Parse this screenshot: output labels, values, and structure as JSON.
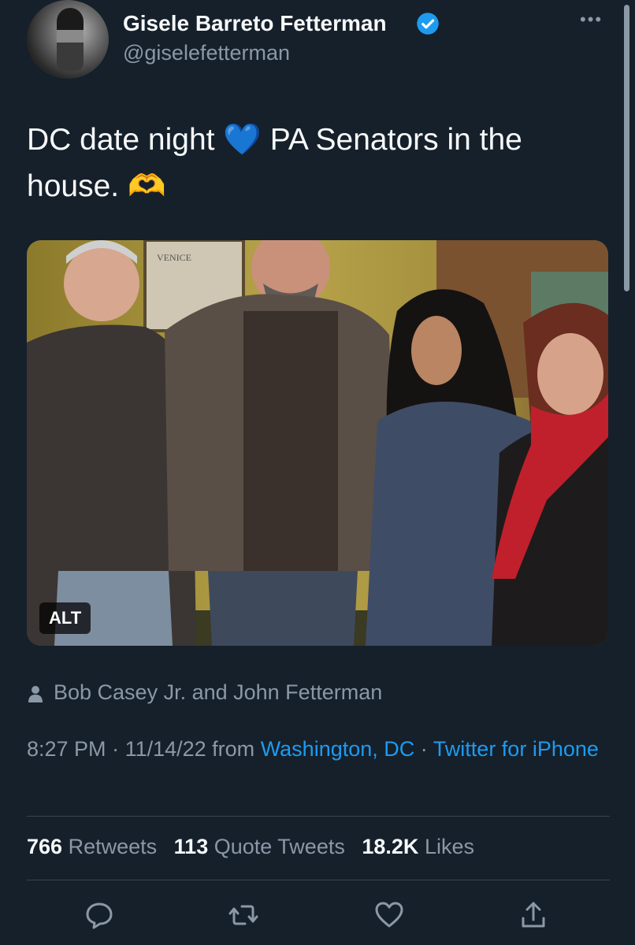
{
  "author": {
    "display_name": "Gisele Barreto Fetterman",
    "handle": "@giselefetterman",
    "verified": true
  },
  "tweet": {
    "text_part1": "DC date night ",
    "text_emoji1": "💙",
    "text_part2": " PA Senators in the house. ",
    "text_emoji2": "🫶"
  },
  "media": {
    "alt_badge": "ALT",
    "venice_sign": "VENICE"
  },
  "tagged": {
    "text": "Bob Casey Jr. and John Fetterman"
  },
  "meta": {
    "time": "8:27 PM",
    "sep1": " · ",
    "date": "11/14/22",
    "from_word": " from ",
    "location": "Washington, DC",
    "sep2": " · ",
    "client": "Twitter for iPhone"
  },
  "stats": {
    "retweets_count": "766",
    "retweets_label": "Retweets",
    "quotes_count": "113",
    "quotes_label": "Quote Tweets",
    "likes_count": "18.2K",
    "likes_label": "Likes"
  },
  "actions": [
    "reply-icon",
    "retweet-icon",
    "like-icon",
    "share-icon"
  ],
  "colors": {
    "background": "#15202b",
    "text": "#f7f9f9",
    "secondary": "#8b98a5",
    "link": "#1d9bf0",
    "divider": "#38444d"
  }
}
